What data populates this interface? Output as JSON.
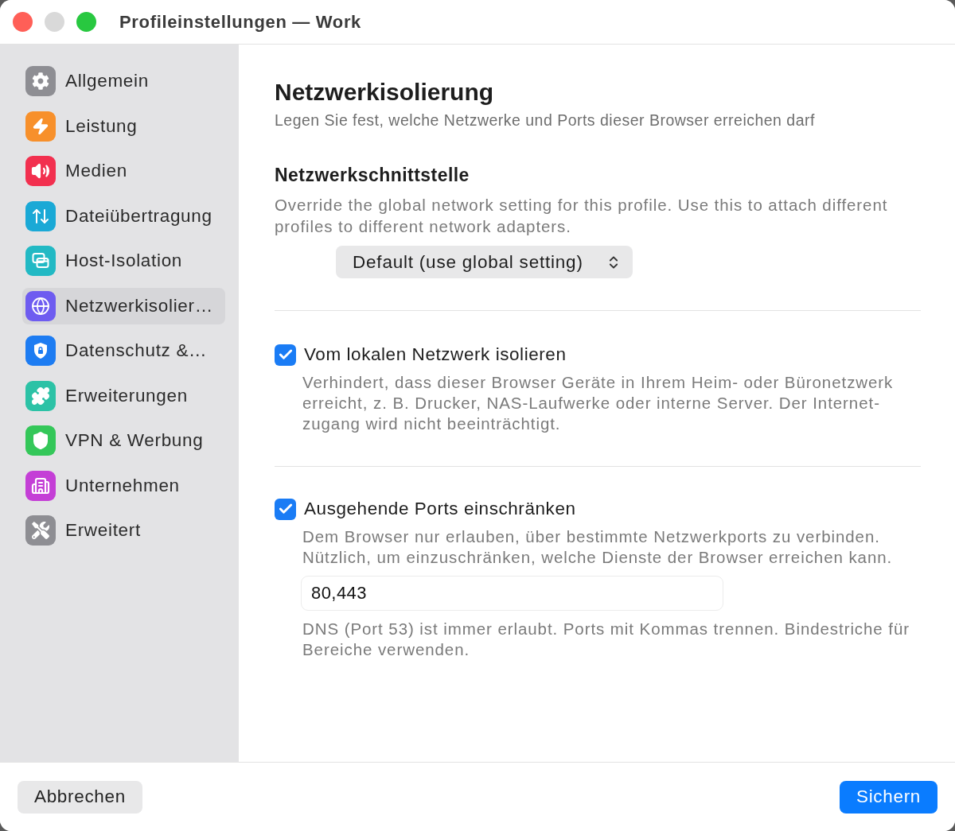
{
  "window": {
    "title": "Profileinstellungen — Work",
    "controls": [
      {
        "kind": "close",
        "disabled": false
      },
      {
        "kind": "minimize",
        "disabled": true
      },
      {
        "kind": "zoom",
        "disabled": false
      }
    ]
  },
  "sidebar": {
    "items": [
      {
        "label": "Allgemein",
        "color": "#8e8e93",
        "selected": false
      },
      {
        "label": "Leistung",
        "color": "#f7902b",
        "selected": false
      },
      {
        "label": "Medien",
        "color": "#f2304f",
        "selected": false
      },
      {
        "label": "Dateiübertragung",
        "color": "#1aa9d6",
        "selected": false
      },
      {
        "label": "Host-Isolation",
        "color": "#22b9c4",
        "selected": false
      },
      {
        "label": "Netzwerkisolier…",
        "color": "#6e5cf0",
        "selected": true
      },
      {
        "label": "Datenschutz &…",
        "color": "#1d7cf2",
        "selected": false
      },
      {
        "label": "Erweiterungen",
        "color": "#2cc2a6",
        "selected": false
      },
      {
        "label": "VPN & Werbung",
        "color": "#34c759",
        "selected": false
      },
      {
        "label": "Unternehmen",
        "color": "#c43fd6",
        "selected": false
      },
      {
        "label": "Erweitert",
        "color": "#8e8e93",
        "selected": false
      }
    ]
  },
  "content": {
    "title": "Netzwerkisolierung",
    "subtitle": "Legen Sie fest, welche Netzwerke und Ports dieser Browser erreichen darf",
    "interface": {
      "heading": "Netzwerkschnittstelle",
      "description": "Override the global network setting for this profile. Use this to attach different profiles to different network adapters.",
      "popup": {
        "value": "Default (use global setting)"
      }
    },
    "options": [
      {
        "label": "Vom lokalen Netzwerk isolieren",
        "checked": true,
        "description": "Verhindert, dass dieser Browser Geräte in Ihrem Heim- oder Büronetzwerk erreicht, z. B. Drucker, NAS-Laufwerke oder interne Server. Der Internet-zugang wird nicht beeinträchtigt."
      },
      {
        "label": "Ausgehende Ports einschränken",
        "checked": true,
        "description": "Dem Browser nur erlauben, über bestimmte Netzwerkports zu verbinden. Nützlich, um einzuschränken, welche Dienste der Browser erreichen kann.",
        "ports_field": {
          "value": "80,443"
        },
        "hint": "DNS (Port 53) ist immer erlaubt. Ports mit Kommas trennen. Bindestriche für Bereiche verwenden."
      }
    ]
  },
  "footer": {
    "buttons": [
      {
        "label": "Abbrechen",
        "kind": "secondary"
      },
      {
        "label": "Sichern",
        "kind": "primary"
      }
    ]
  }
}
